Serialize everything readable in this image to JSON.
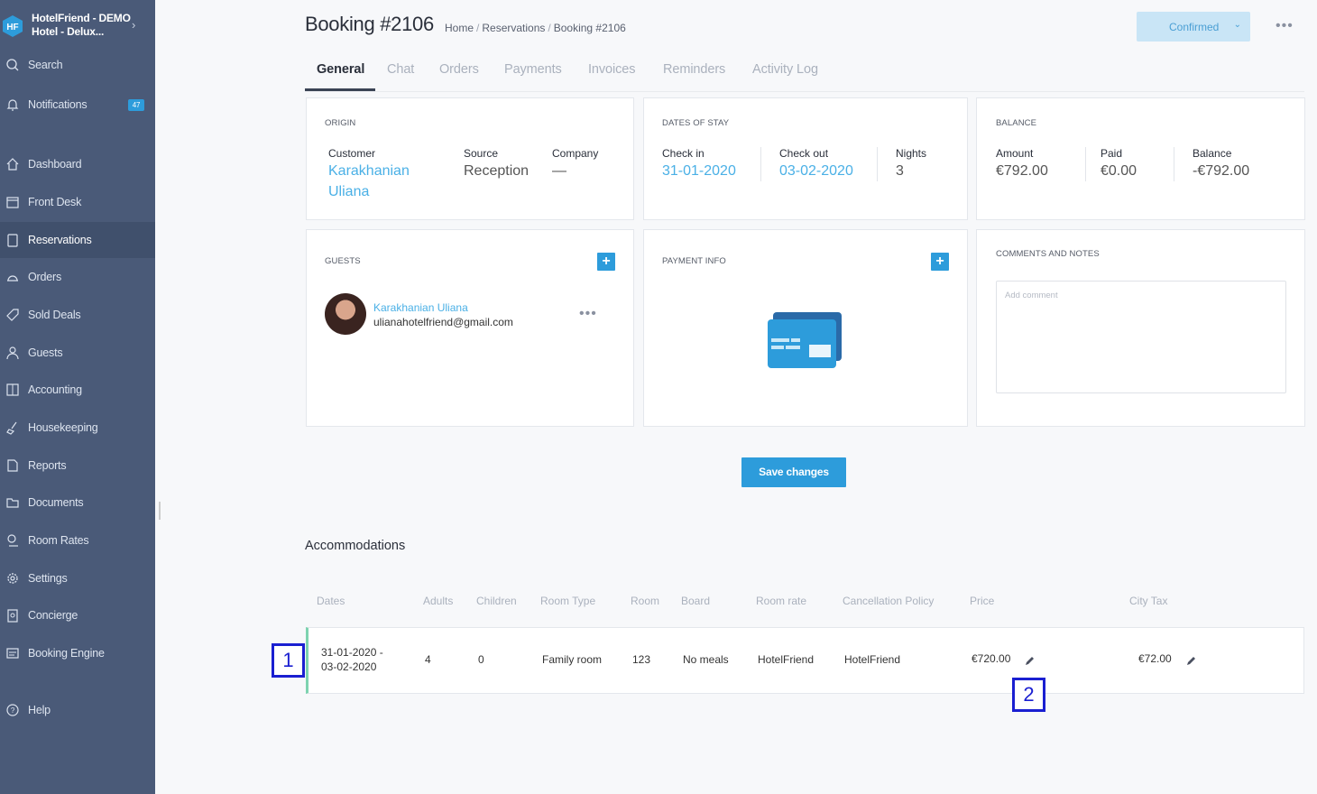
{
  "brand": {
    "line1": "HotelFriend - DEMO",
    "line2": "Hotel - Delux..."
  },
  "sidebar": {
    "search": "Search",
    "notifications": "Notifications",
    "notifications_count": "47",
    "items": [
      {
        "label": "Dashboard",
        "icon": "home-icon"
      },
      {
        "label": "Front Desk",
        "icon": "calendar-icon"
      },
      {
        "label": "Reservations",
        "icon": "clipboard-icon"
      },
      {
        "label": "Orders",
        "icon": "cloche-icon"
      },
      {
        "label": "Sold Deals",
        "icon": "tag-icon"
      },
      {
        "label": "Guests",
        "icon": "user-icon"
      },
      {
        "label": "Accounting",
        "icon": "ledger-icon"
      },
      {
        "label": "Housekeeping",
        "icon": "broom-icon"
      },
      {
        "label": "Reports",
        "icon": "report-icon"
      },
      {
        "label": "Documents",
        "icon": "folder-icon"
      },
      {
        "label": "Room Rates",
        "icon": "rates-icon"
      },
      {
        "label": "Settings",
        "icon": "gear-icon"
      },
      {
        "label": "Concierge",
        "icon": "concierge-icon"
      },
      {
        "label": "Booking Engine",
        "icon": "booking-icon"
      }
    ],
    "help": "Help"
  },
  "header": {
    "title": "Booking #2106",
    "breadcrumb": [
      "Home",
      "Reservations",
      "Booking #2106"
    ],
    "status": "Confirmed"
  },
  "tabs": [
    "General",
    "Chat",
    "Orders",
    "Payments",
    "Invoices",
    "Reminders",
    "Activity Log"
  ],
  "origin": {
    "title": "ORIGIN",
    "customer_label": "Customer",
    "customer_line1": "Karakhanian",
    "customer_line2": "Uliana",
    "source_label": "Source",
    "source_value": "Reception",
    "company_label": "Company",
    "company_value": "—"
  },
  "dates": {
    "title": "DATES OF STAY",
    "checkin_label": "Check in",
    "checkin_value": "31-01-2020",
    "checkout_label": "Check out",
    "checkout_value": "03-02-2020",
    "nights_label": "Nights",
    "nights_value": "3"
  },
  "balance": {
    "title": "BALANCE",
    "amount_label": "Amount",
    "amount_value": "€792.00",
    "paid_label": "Paid",
    "paid_value": "€0.00",
    "balance_label": "Balance",
    "balance_value": "-€792.00"
  },
  "guests": {
    "title": "GUESTS",
    "name": "Karakhanian Uliana",
    "email": "ulianahotelfriend@gmail.com"
  },
  "payment": {
    "title": "PAYMENT INFO"
  },
  "comments": {
    "title": "COMMENTS AND NOTES",
    "placeholder": "Add comment"
  },
  "save_label": "Save changes",
  "accommodations": {
    "title": "Accommodations",
    "columns": [
      "Dates",
      "Adults",
      "Children",
      "Room Type",
      "Room",
      "Board",
      "Room rate",
      "Cancellation Policy",
      "Price",
      "City Tax"
    ],
    "row": {
      "dates_line1": "31-01-2020 -",
      "dates_line2": "03-02-2020",
      "adults": "4",
      "children": "0",
      "room_type": "Family room",
      "room": "123",
      "board": "No meals",
      "room_rate": "HotelFriend",
      "cancellation": "HotelFriend",
      "price": "€720.00",
      "city_tax": "€72.00"
    }
  },
  "markers": [
    "1",
    "2"
  ]
}
